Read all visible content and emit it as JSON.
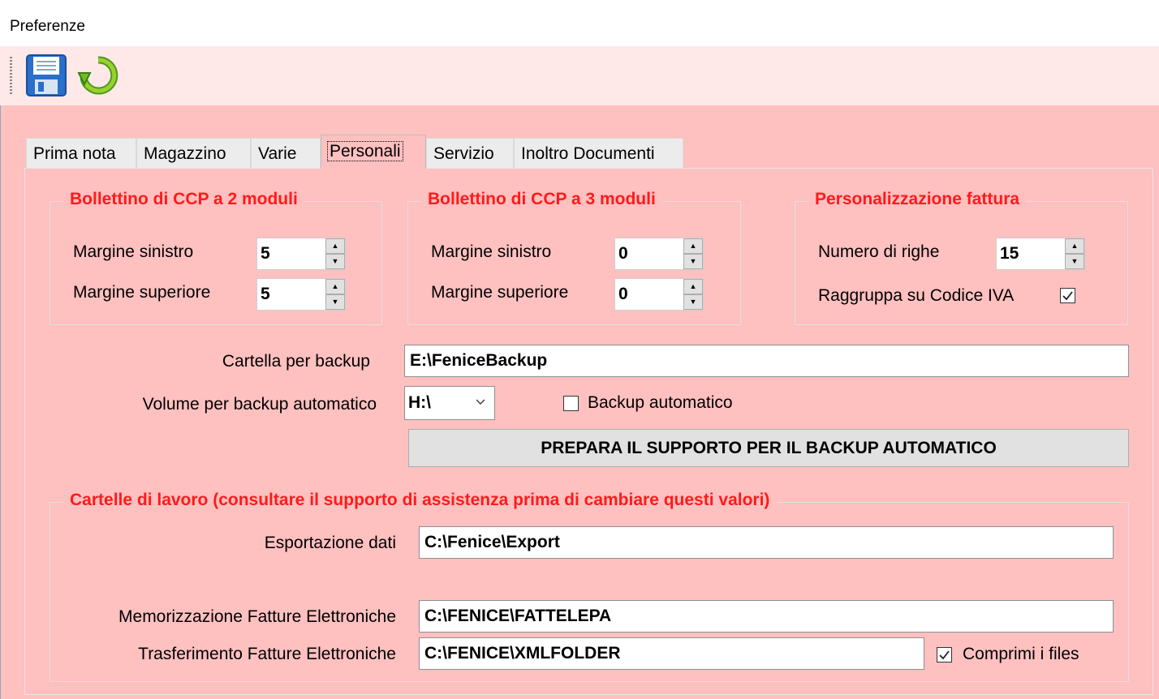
{
  "window": {
    "title": "Preferenze"
  },
  "toolbar": {
    "save_icon": "floppy-disk-icon",
    "refresh_icon": "refresh-arrow-icon"
  },
  "tabs": [
    {
      "label": "Prima nota"
    },
    {
      "label": "Magazzino"
    },
    {
      "label": "Varie"
    },
    {
      "label": "Personali",
      "active": true
    },
    {
      "label": "Servizio"
    },
    {
      "label": "Inoltro Documenti"
    }
  ],
  "ccp2": {
    "title": "Bollettino di CCP a 2 moduli",
    "left_margin_label": "Margine sinistro",
    "left_margin_value": "5",
    "top_margin_label": "Margine superiore",
    "top_margin_value": "5"
  },
  "ccp3": {
    "title": "Bollettino di CCP a 3 moduli",
    "left_margin_label": "Margine sinistro",
    "left_margin_value": "0",
    "top_margin_label": "Margine superiore",
    "top_margin_value": "0"
  },
  "invoice": {
    "title": "Personalizzazione fattura",
    "rows_label": "Numero di righe",
    "rows_value": "15",
    "group_vat_label": "Raggruppa su Codice IVA",
    "group_vat_checked": true
  },
  "backup": {
    "folder_label": "Cartella per backup",
    "folder_value": "E:\\FeniceBackup",
    "volume_label": "Volume per backup automatico",
    "volume_value": "H:\\",
    "auto_label": "Backup automatico",
    "auto_checked": false,
    "prepare_button": "PREPARA IL SUPPORTO PER IL BACKUP AUTOMATICO"
  },
  "work_folders": {
    "title": "Cartelle di lavoro (consultare il supporto di assistenza prima di cambiare questi valori)",
    "export_label": "Esportazione dati",
    "export_value": "C:\\Fenice\\Export",
    "einvoice_store_label": "Memorizzazione Fatture Elettroniche",
    "einvoice_store_value": "C:\\FENICE\\FATTELEPA",
    "einvoice_transfer_label": "Trasferimento Fatture Elettroniche",
    "einvoice_transfer_value": "C:\\FENICE\\XMLFOLDER",
    "compress_label": "Comprimi i files",
    "compress_checked": true
  },
  "colors": {
    "background": "#ffc0c0",
    "group_title": "#ff1a1a"
  }
}
